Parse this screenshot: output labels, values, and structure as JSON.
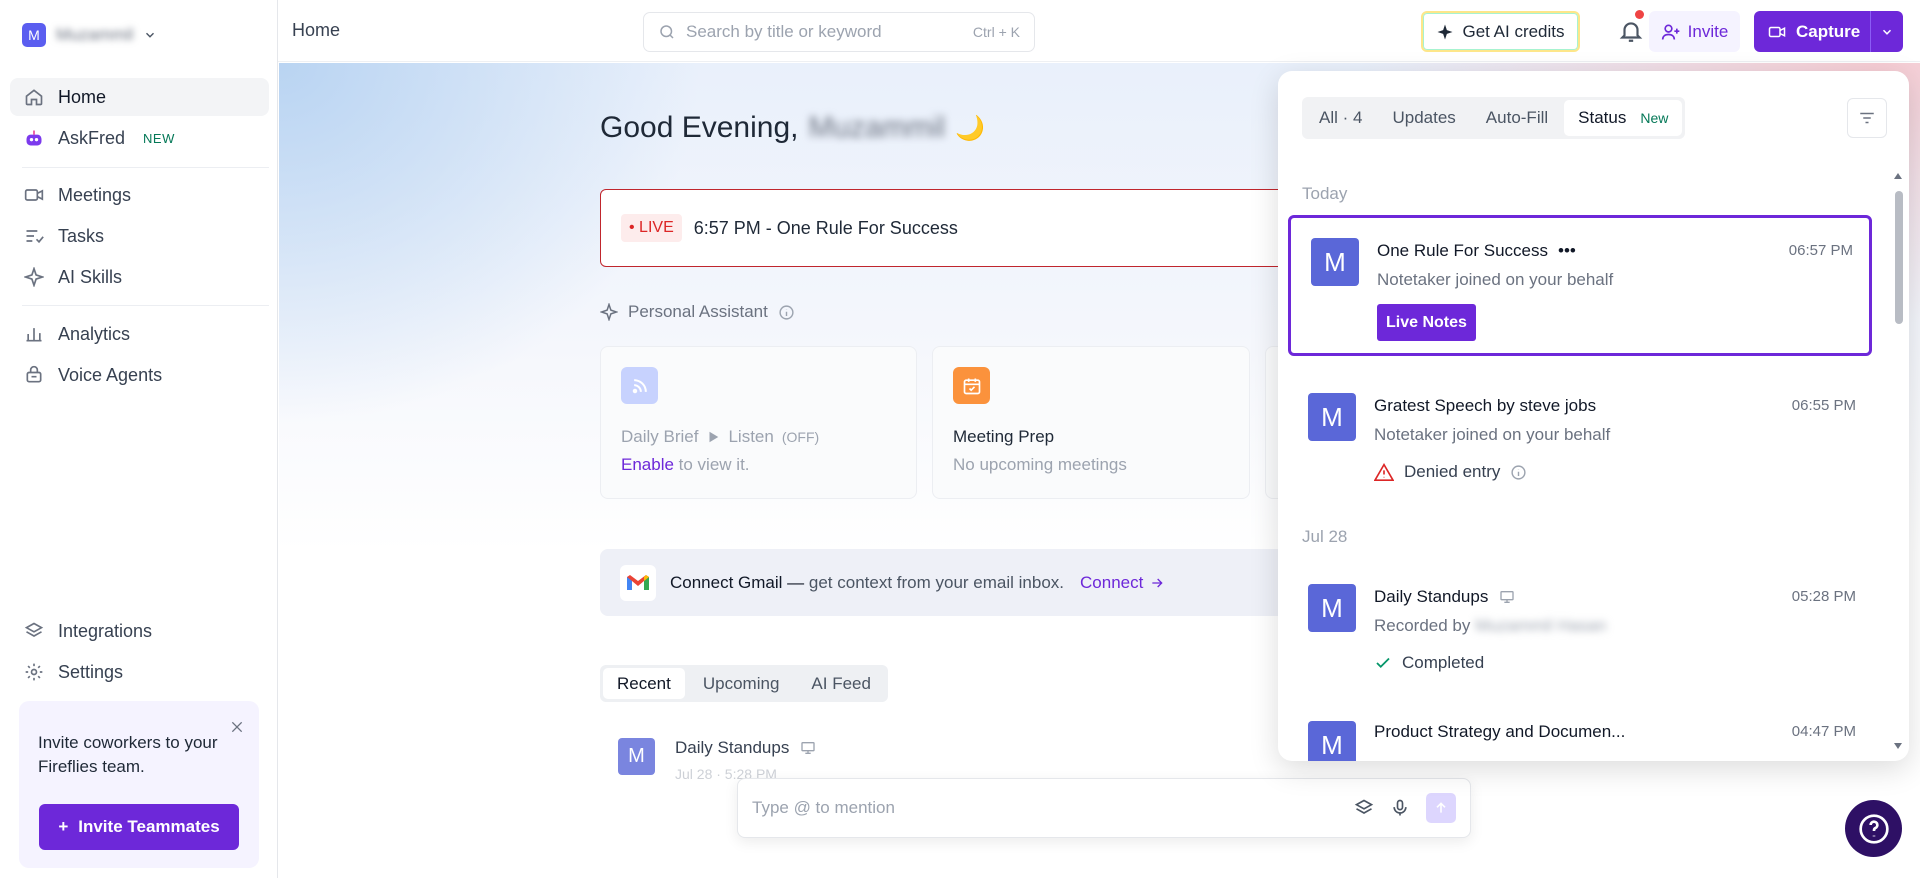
{
  "sidebar": {
    "workspace_initial": "M",
    "workspace_name": "Muzammil",
    "items": [
      {
        "label": "Home"
      },
      {
        "label": "AskFred",
        "badge": "NEW"
      },
      {
        "label": "Meetings"
      },
      {
        "label": "Tasks"
      },
      {
        "label": "AI Skills"
      },
      {
        "label": "Analytics"
      },
      {
        "label": "Voice Agents"
      },
      {
        "label": "Integrations"
      },
      {
        "label": "Settings"
      }
    ],
    "invite_card": {
      "text": "Invite coworkers to your Fireflies team.",
      "button": "Invite Teammates"
    }
  },
  "topbar": {
    "breadcrumb": "Home",
    "search_placeholder": "Search by title or keyword",
    "search_shortcut": "Ctrl + K",
    "ai_credits_label": "Get AI credits",
    "invite_label": "Invite",
    "capture_label": "Capture"
  },
  "main": {
    "greeting": "Good Evening,",
    "user_name": "Muzammil",
    "greeting_emoji": "🌙",
    "live_meeting": {
      "tag": "LIVE",
      "title": "6:57 PM - One Rule For Success"
    },
    "personal_assistant": {
      "label": "Personal Assistant",
      "cards": [
        {
          "title": "Daily Brief",
          "listen": "Listen",
          "listen_state": "(OFF)",
          "sub_link": "Enable",
          "sub": " to view it."
        },
        {
          "title": "Meeting Prep",
          "sub": "No upcoming meetings"
        }
      ]
    },
    "gmail": {
      "title": "Connect Gmail —",
      "desc": " get context from your email inbox.",
      "cta": "Connect"
    },
    "tabs": [
      {
        "label": "Recent",
        "active": true
      },
      {
        "label": "Upcoming"
      },
      {
        "label": "AI Feed"
      }
    ],
    "recent": [
      {
        "initial": "M",
        "title": "Daily Standups",
        "date": "Jul 28 · 5:28 PM"
      }
    ],
    "compose_placeholder": "Type @ to mention"
  },
  "notifications": {
    "tabs": [
      {
        "label": "All · 4"
      },
      {
        "label": "Updates"
      },
      {
        "label": "Auto-Fill"
      },
      {
        "label": "Status",
        "badge": "New",
        "active": true
      }
    ],
    "groups": [
      {
        "day": "Today",
        "items": [
          {
            "initial": "M",
            "title": "One Rule For Success",
            "menu": "•••",
            "time": "06:57 PM",
            "desc": "Notetaker joined on your behalf",
            "action": "Live Notes",
            "selected": true
          },
          {
            "initial": "M",
            "title": "Gratest Speech by steve jobs",
            "time": "06:55 PM",
            "desc": "Notetaker joined on your behalf",
            "status": "Denied entry"
          }
        ]
      },
      {
        "day": "Jul 28",
        "items": [
          {
            "initial": "M",
            "title": "Daily Standups",
            "time": "05:28 PM",
            "desc": "Recorded by",
            "desc_name": "Muzammil Hasan",
            "status": "Completed"
          },
          {
            "initial": "M",
            "title": "Product Strategy and Documen...",
            "time": "04:47 PM"
          }
        ]
      }
    ]
  },
  "colors": {
    "accent": "#6d28d9",
    "live": "#dc2626",
    "avatar": "#5a67d8"
  }
}
